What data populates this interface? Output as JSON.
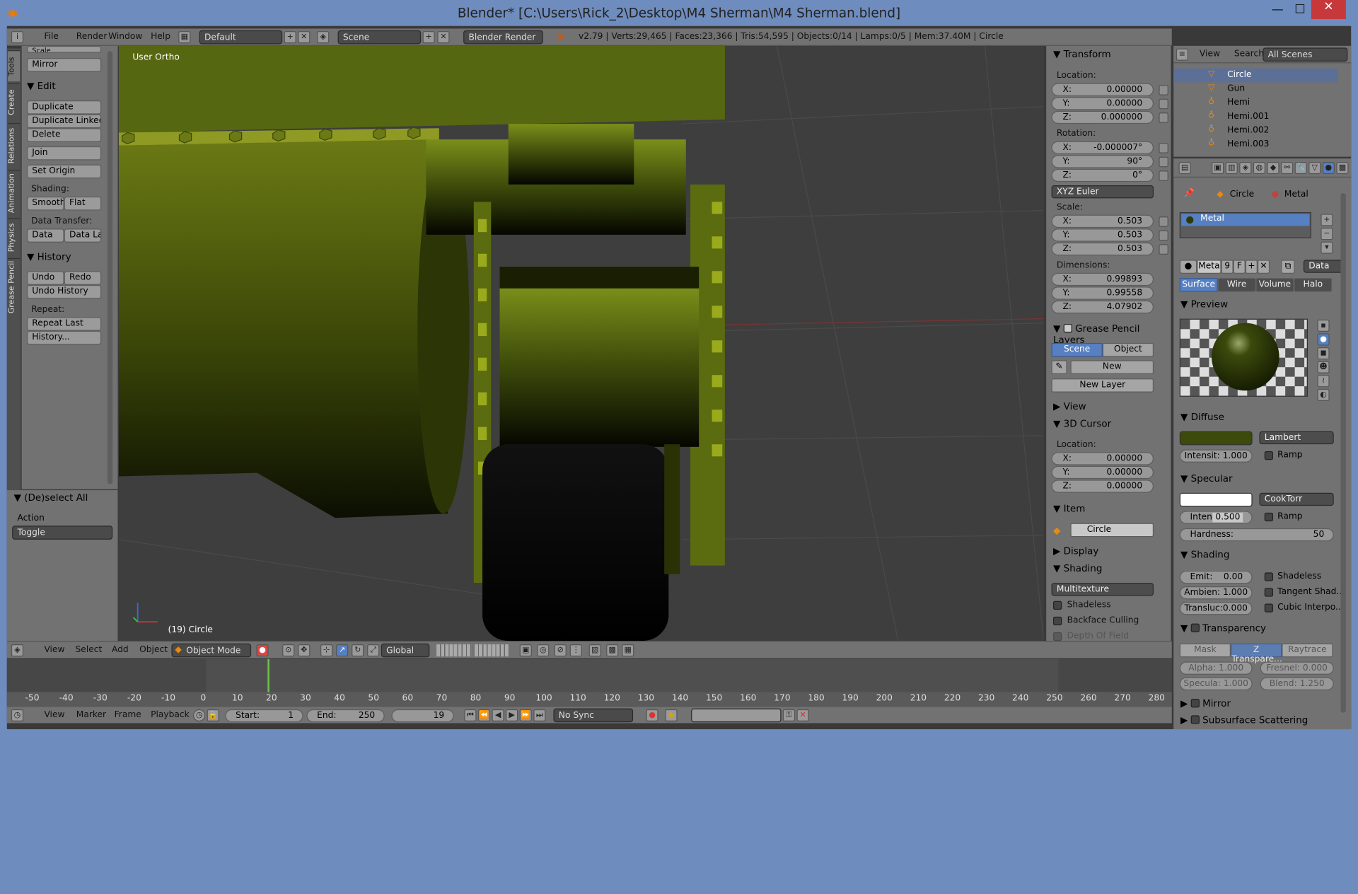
{
  "window": {
    "title": "Blender* [C:\\Users\\Rick_2\\Desktop\\M4 Sherman\\M4 Sherman.blend]",
    "minimize": "—",
    "maximize": "☐",
    "close": "✕"
  },
  "menu": {
    "file": "File",
    "render": "Render",
    "window": "Window",
    "help": "Help",
    "layout": "Default",
    "scene": "Scene",
    "engine": "Blender Render",
    "info": "v2.79 | Verts:29,465 | Faces:23,366 | Tris:54,595 | Objects:0/14 | Lamps:0/5 | Mem:37.40M | Circle"
  },
  "tabs": [
    "Tools",
    "Create",
    "Relations",
    "Animation",
    "Physics",
    "Grease Pencil"
  ],
  "tools": {
    "scale": "Scale",
    "mirror": "Mirror",
    "edit_header": "Edit",
    "duplicate": "Duplicate",
    "duplicate_linked": "Duplicate Linked",
    "delete": "Delete",
    "join": "Join",
    "set_origin": "Set Origin",
    "shading_label": "Shading:",
    "smooth": "Smooth",
    "flat": "Flat",
    "data_transfer_label": "Data Transfer:",
    "data": "Data",
    "data_la": "Data La",
    "history_header": "History",
    "undo": "Undo",
    "redo": "Redo",
    "undo_history": "Undo History",
    "repeat_label": "Repeat:",
    "repeat_last": "Repeat Last",
    "history_btn": "History..."
  },
  "operator": {
    "title": "(De)select All",
    "action_label": "Action",
    "action_value": "Toggle"
  },
  "viewport": {
    "mode_label": "User Ortho",
    "object_label": "(19) Circle"
  },
  "npanel": {
    "transform": "Transform",
    "location": "Location:",
    "loc": [
      "0.00000",
      "0.00000",
      "0.000000"
    ],
    "rotation": "Rotation:",
    "rot": [
      "-0.000007°",
      "90°",
      "0°"
    ],
    "rot_mode": "XYZ Euler",
    "scale": "Scale:",
    "scl": [
      "0.503",
      "0.503",
      "0.503"
    ],
    "dimensions": "Dimensions:",
    "dim": [
      "0.99893",
      "0.99558",
      "4.07902"
    ],
    "axes": [
      "X:",
      "Y:",
      "Z:"
    ],
    "gp_layers": "Grease Pencil Layers",
    "scene_btn": "Scene",
    "object_btn": "Object",
    "new_btn": "New",
    "new_layer": "New Layer",
    "view": "View",
    "cursor": "3D Cursor",
    "cursor_location": "Location:",
    "cur": [
      "0.00000",
      "0.00000",
      "0.00000"
    ],
    "item": "Item",
    "item_name": "Circle",
    "display": "Display",
    "shading": "Shading",
    "shading_mode": "Multitexture",
    "shadeless": "Shadeless",
    "backface": "Backface Culling",
    "dof": "Depth Of Field"
  },
  "outliner": {
    "view": "View",
    "search": "Search",
    "filter": "All Scenes",
    "items": [
      "Circle",
      "Gun",
      "Hemi",
      "Hemi.001",
      "Hemi.002",
      "Hemi.003"
    ]
  },
  "properties": {
    "breadcrumb_obj": "Circle",
    "breadcrumb_mat": "Metal",
    "slot": "Metal",
    "mat_name": "Meta",
    "users": "9",
    "fake": "F",
    "data_sel": "Data",
    "tabs": [
      "Surface",
      "Wire",
      "Volume",
      "Halo"
    ],
    "preview": "Preview",
    "diffuse": "Diffuse",
    "diffuse_color": "#3c4a0c",
    "diffuse_shader": "Lambert",
    "diffuse_intensity": "Intensit: 1.000",
    "ramp": "Ramp",
    "specular": "Specular",
    "spec_shader": "CookTorr",
    "spec_intensity_k": "Intensit:",
    "spec_intensity_v": "0.500",
    "hardness_k": "Hardness:",
    "hardness_v": "50",
    "shading": "Shading",
    "emit_k": "Emit:",
    "emit_v": "0.00",
    "ambient": "Ambien: 1.000",
    "transluc": "Transluc:0.000",
    "shadeless": "Shadeless",
    "tangent": "Tangent Shad...",
    "cubic": "Cubic Interpo...",
    "transparency": "Transparency",
    "mask": "Mask",
    "ztransp": "Z Transpare...",
    "raytrace": "Raytrace",
    "alpha": "Alpha: 1.000",
    "fresnel": "Fresnel: 0.000",
    "specular_t": "Specula: 1.000",
    "blend": "Blend: 1.250",
    "mirror": "Mirror",
    "sss": "Subsurface Scattering"
  },
  "header3d": {
    "view": "View",
    "select": "Select",
    "add": "Add",
    "object": "Object",
    "mode": "Object Mode",
    "orientation": "Global"
  },
  "timeline": {
    "ticks": [
      "-50",
      "-40",
      "-30",
      "-20",
      "-10",
      "0",
      "10",
      "20",
      "30",
      "40",
      "50",
      "60",
      "70",
      "80",
      "90",
      "100",
      "110",
      "120",
      "130",
      "140",
      "150",
      "160",
      "170",
      "180",
      "190",
      "200",
      "210",
      "220",
      "230",
      "240",
      "250",
      "260",
      "270",
      "280"
    ],
    "current_frame": 19,
    "view": "View",
    "marker": "Marker",
    "frame": "Frame",
    "playback": "Playback",
    "start_k": "Start:",
    "start_v": "1",
    "end_k": "End:",
    "end_v": "250",
    "cur_v": "19",
    "sync": "No Sync"
  }
}
